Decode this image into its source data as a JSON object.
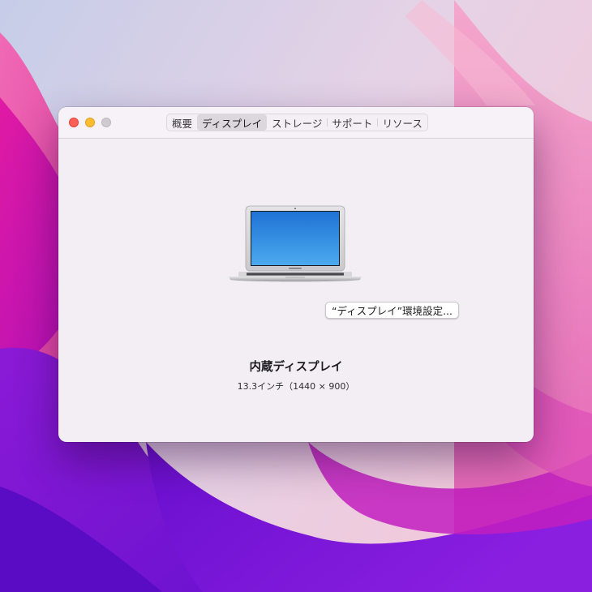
{
  "window": {
    "tabs": [
      {
        "label": "概要",
        "active": false
      },
      {
        "label": "ディスプレイ",
        "active": true
      },
      {
        "label": "ストレージ",
        "active": false
      },
      {
        "label": "サポート",
        "active": false
      },
      {
        "label": "リソース",
        "active": false
      }
    ]
  },
  "display": {
    "name": "内蔵ディスプレイ",
    "size": "13.3インチ（1440 × 900）"
  },
  "actions": {
    "prefs_button_label": "“ディスプレイ”環境設定..."
  },
  "colors": {
    "close": "#fe5f57",
    "minimize": "#febc2e",
    "zoom_disabled": "#cfcacf",
    "window_bg": "#f2eef3"
  },
  "icons": {
    "laptop": "macbook-air-icon"
  }
}
